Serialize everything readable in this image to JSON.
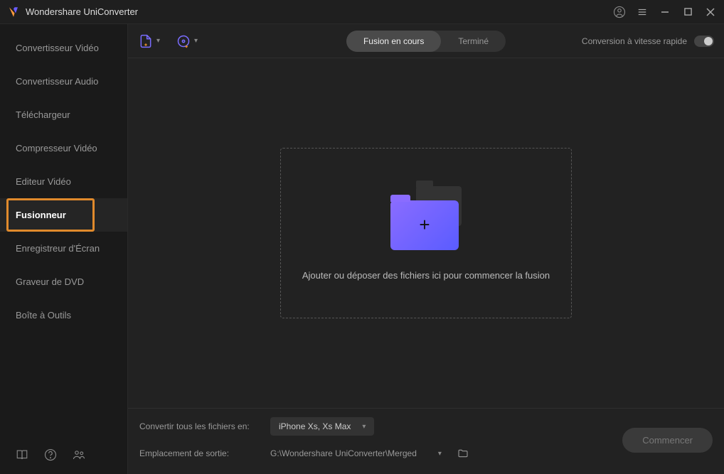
{
  "app": {
    "title": "Wondershare UniConverter"
  },
  "titlebar_icons": [
    "account",
    "menu",
    "minimize",
    "maximize",
    "close"
  ],
  "sidebar": {
    "items": [
      {
        "label": "Convertisseur Vidéo"
      },
      {
        "label": "Convertisseur Audio"
      },
      {
        "label": "Téléchargeur"
      },
      {
        "label": "Compresseur Vidéo"
      },
      {
        "label": "Editeur Vidéo"
      },
      {
        "label": "Fusionneur",
        "active": true
      },
      {
        "label": "Enregistreur d'Écran"
      },
      {
        "label": "Graveur de DVD"
      },
      {
        "label": "Boîte à Outils"
      }
    ],
    "footer_icons": [
      "book",
      "help",
      "community"
    ]
  },
  "toolbar": {
    "icons": [
      "add-file",
      "add-disc"
    ],
    "tabs": [
      {
        "label": "Fusion en cours",
        "active": true
      },
      {
        "label": "Terminé"
      }
    ],
    "speed_label": "Conversion à vitesse rapide"
  },
  "dropzone": {
    "text": "Ajouter ou déposer des fichiers ici pour commencer la fusion"
  },
  "bottom": {
    "convert_label": "Convertir tous les fichiers en:",
    "convert_value": "iPhone Xs, Xs Max",
    "output_label": "Emplacement de sortie:",
    "output_value": "G:\\Wondershare UniConverter\\Merged",
    "start_label": "Commencer"
  }
}
